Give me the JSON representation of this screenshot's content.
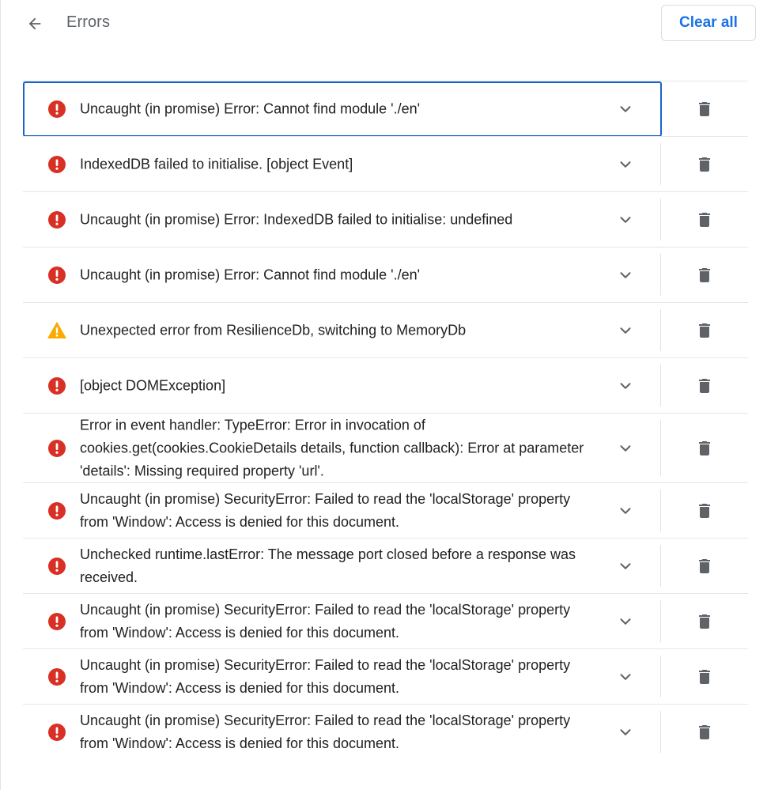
{
  "header": {
    "title": "Errors",
    "back_icon": "arrow-back-icon",
    "clear_label": "Clear all"
  },
  "colors": {
    "error": "#d93025",
    "warning": "#f9ab00",
    "accent": "#1a73e8",
    "focus_border": "#1a64c8",
    "icon_gray": "#5f6368"
  },
  "errors": [
    {
      "severity": "error",
      "message": "Uncaught (in promise) Error: Cannot find module './en'",
      "selected": true
    },
    {
      "severity": "error",
      "message": "IndexedDB failed to initialise. [object Event]"
    },
    {
      "severity": "error",
      "message": "Uncaught (in promise) Error: IndexedDB failed to initialise: undefined"
    },
    {
      "severity": "error",
      "message": "Uncaught (in promise) Error: Cannot find module './en'"
    },
    {
      "severity": "warning",
      "message": "Unexpected error from ResilienceDb, switching to MemoryDb"
    },
    {
      "severity": "error",
      "message": "[object DOMException]"
    },
    {
      "severity": "error",
      "message": "Error in event handler: TypeError: Error in invocation of cookies.get(cookies.CookieDetails details, function callback): Error at parameter 'details': Missing required property 'url'."
    },
    {
      "severity": "error",
      "message": "Uncaught (in promise) SecurityError: Failed to read the 'localStorage' property from 'Window': Access is denied for this document."
    },
    {
      "severity": "error",
      "message": "Unchecked runtime.lastError: The message port closed before a response was received."
    },
    {
      "severity": "error",
      "message": "Uncaught (in promise) SecurityError: Failed to read the 'localStorage' property from 'Window': Access is denied for this document."
    },
    {
      "severity": "error",
      "message": "Uncaught (in promise) SecurityError: Failed to read the 'localStorage' property from 'Window': Access is denied for this document."
    },
    {
      "severity": "error",
      "message": "Uncaught (in promise) SecurityError: Failed to read the 'localStorage' property from 'Window': Access is denied for this document."
    }
  ]
}
